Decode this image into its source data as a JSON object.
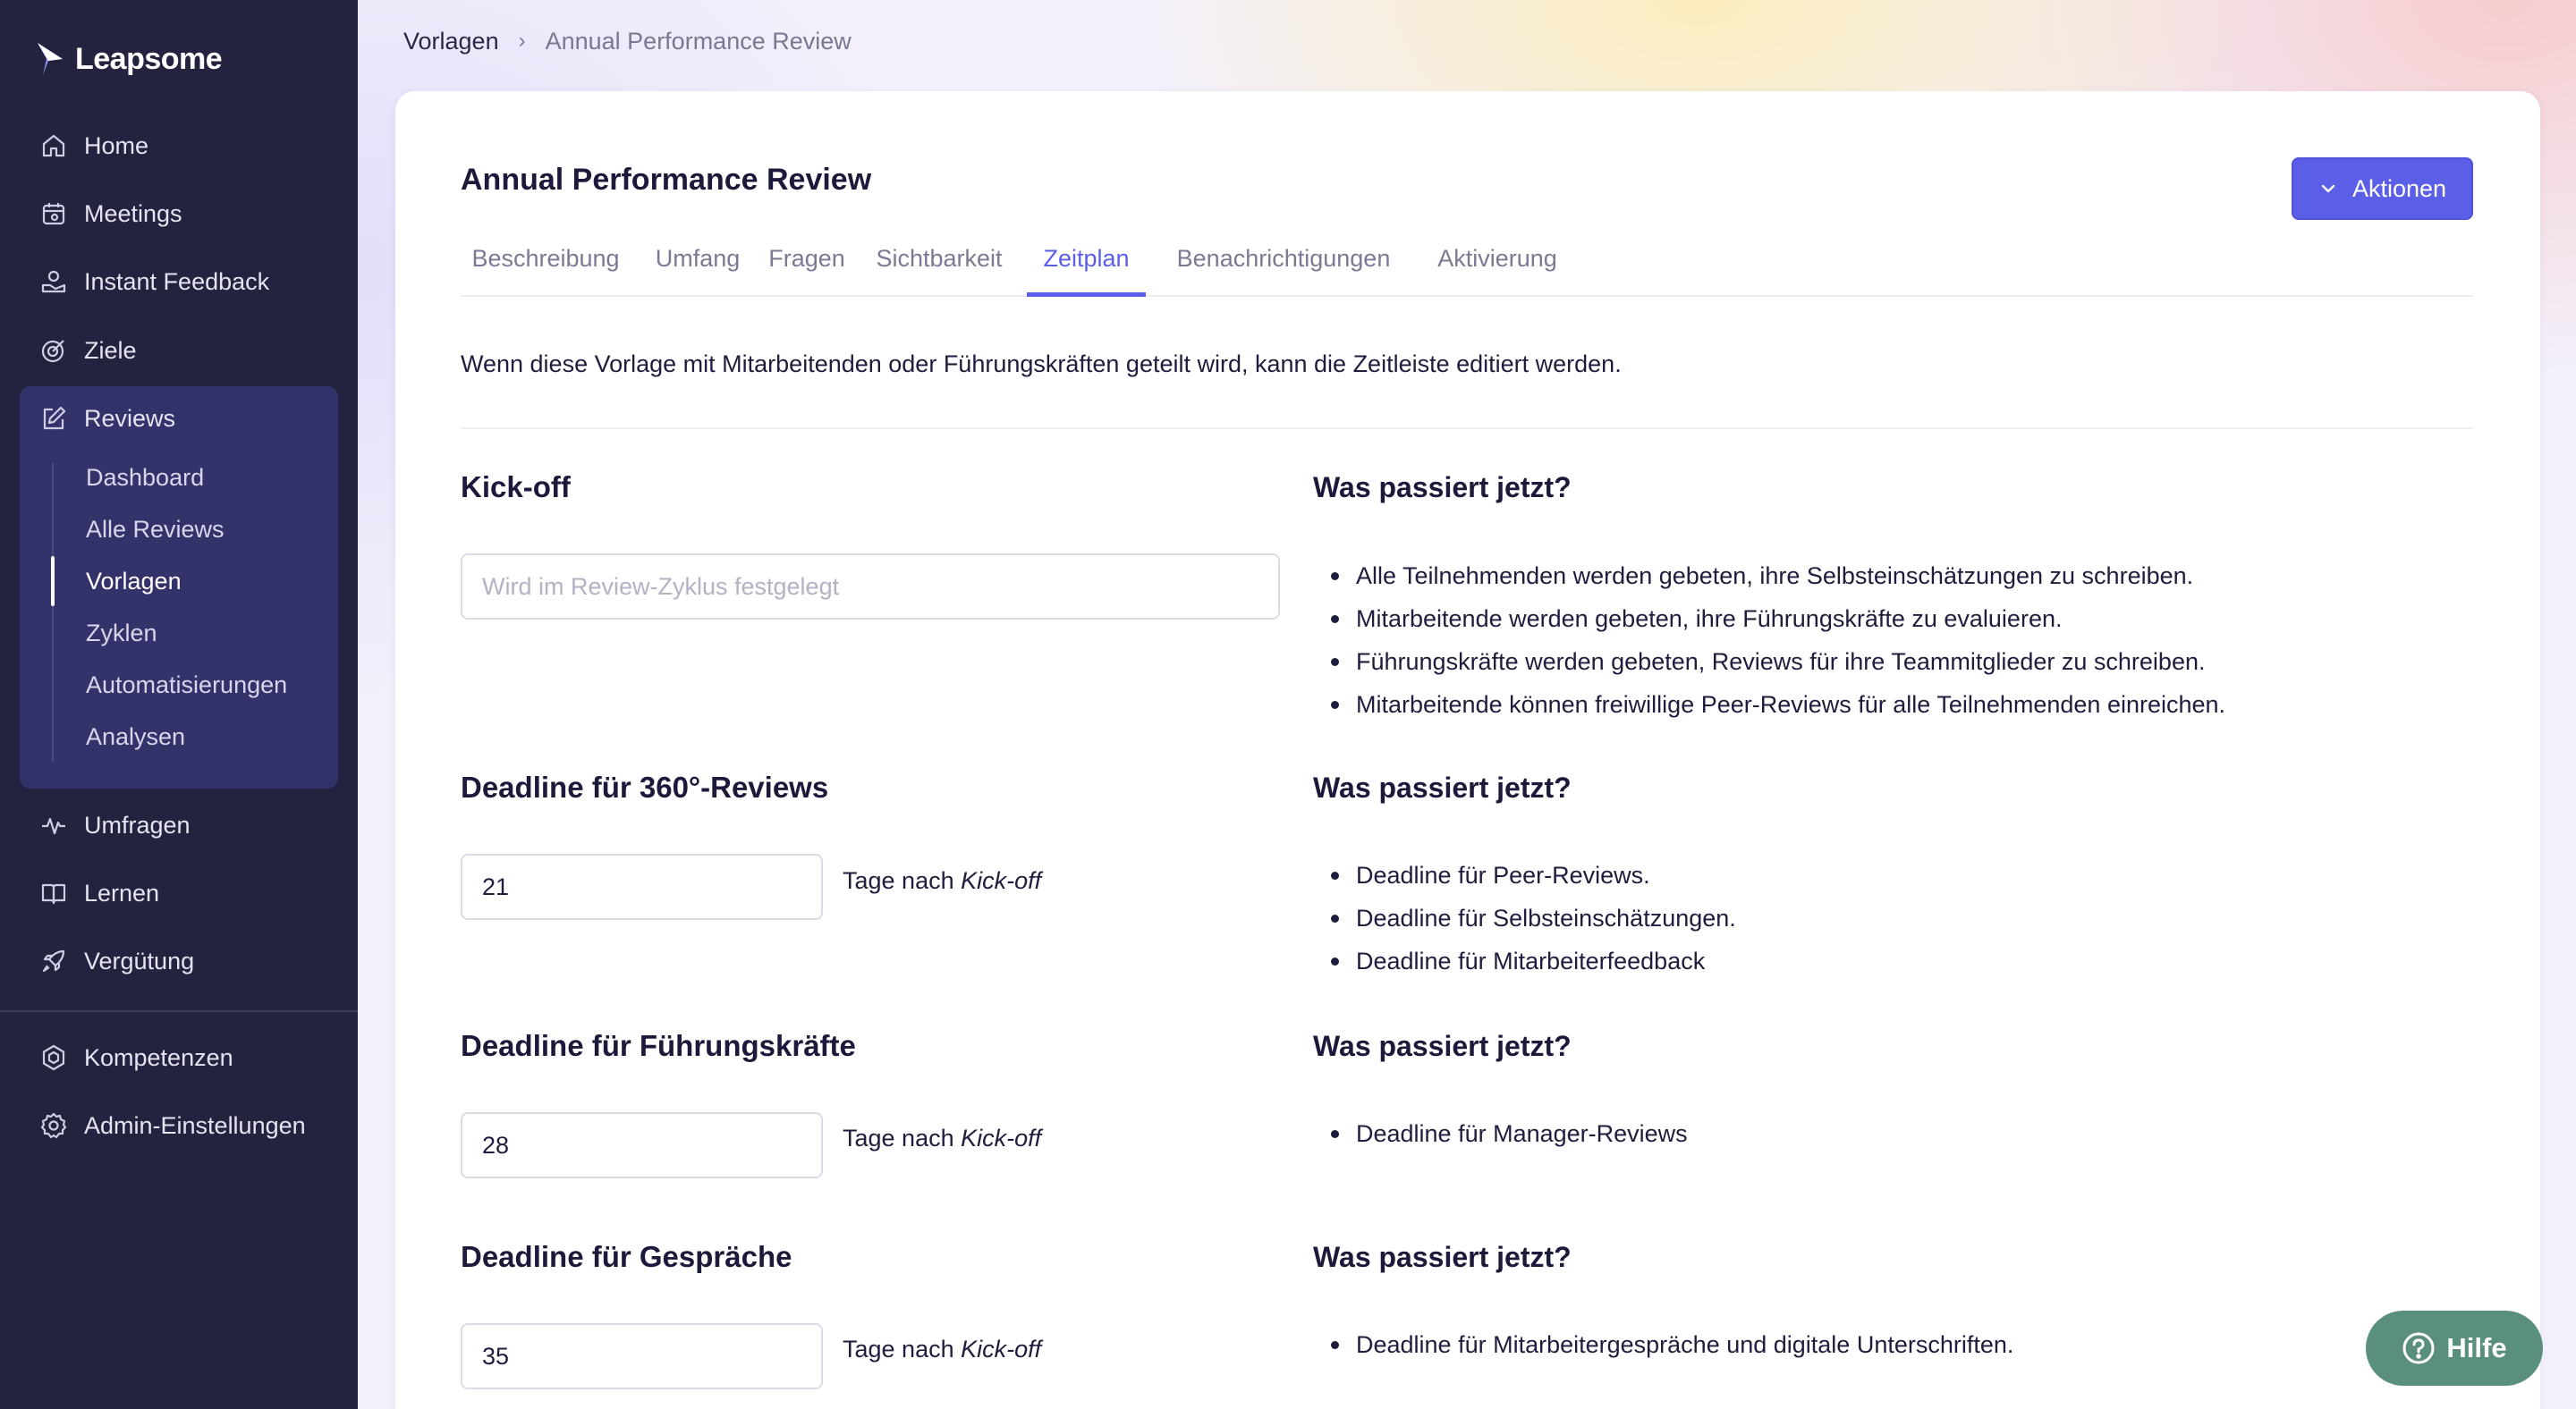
{
  "app": {
    "name": "Leapsome"
  },
  "sidebar": {
    "items": [
      {
        "label": "Home",
        "icon": "home-icon"
      },
      {
        "label": "Meetings",
        "icon": "calendar-icon"
      },
      {
        "label": "Instant Feedback",
        "icon": "feedback-icon"
      },
      {
        "label": "Ziele",
        "icon": "target-icon"
      },
      {
        "label": "Reviews",
        "icon": "edit-icon"
      }
    ],
    "reviews_sub": [
      "Dashboard",
      "Alle Reviews",
      "Vorlagen",
      "Zyklen",
      "Automatisierungen",
      "Analysen"
    ],
    "active_sub": "Vorlagen",
    "lower_items": [
      {
        "label": "Umfragen",
        "icon": "pulse-icon"
      },
      {
        "label": "Lernen",
        "icon": "book-icon"
      },
      {
        "label": "Vergütung",
        "icon": "rocket-icon"
      }
    ],
    "bottom_items": [
      {
        "label": "Kompetenzen",
        "icon": "competency-icon"
      },
      {
        "label": "Admin-Einstellungen",
        "icon": "gear-icon"
      }
    ]
  },
  "breadcrumb": {
    "parent": "Vorlagen",
    "separator": "›",
    "current": "Annual Performance Review"
  },
  "page": {
    "title": "Annual Performance Review",
    "actions_label": "Aktionen",
    "tabs": [
      "Beschreibung",
      "Umfang",
      "Fragen",
      "Sichtbarkeit",
      "Zeitplan",
      "Benachrichtigungen",
      "Aktivierung"
    ],
    "active_tab": "Zeitplan",
    "intro": "Wenn diese Vorlage mit Mitarbeitenden oder Führungskräften geteilt wird, kann die Zeitleiste editiert werden."
  },
  "schedule": {
    "days_after_prefix": "Tage nach",
    "days_after_ref": "Kick-off",
    "what_happens": "Was passiert jetzt?",
    "kickoff": {
      "title": "Kick-off",
      "placeholder": "Wird im Review-Zyklus festgelegt",
      "bullets": [
        "Alle Teilnehmenden werden gebeten, ihre Selbsteinschätzungen zu schreiben.",
        "Mitarbeitende werden gebeten, ihre Führungskräfte zu evaluieren.",
        "Führungskräfte werden gebeten, Reviews für ihre Teammitglieder zu schreiben.",
        "Mitarbeitende können freiwillige Peer-Reviews für alle Teilnehmenden einreichen."
      ]
    },
    "deadline360": {
      "title": "Deadline für 360°-Reviews",
      "value": "21",
      "bullets": [
        "Deadline für Peer-Reviews.",
        "Deadline für Selbsteinschätzungen.",
        "Deadline für Mitarbeiterfeedback"
      ]
    },
    "deadlineManager": {
      "title": "Deadline für Führungskräfte",
      "value": "28",
      "bullets": [
        "Deadline für Manager-Reviews"
      ]
    },
    "deadlineMeetings": {
      "title": "Deadline für Gespräche",
      "value": "35",
      "bullets": [
        "Deadline für Mitarbeitergespräche und digitale Unterschriften."
      ]
    }
  },
  "help": {
    "label": "Hilfe"
  },
  "colors": {
    "sidebar": "#23223f",
    "accent": "#5b5ee6",
    "help": "#5a8f7d"
  }
}
